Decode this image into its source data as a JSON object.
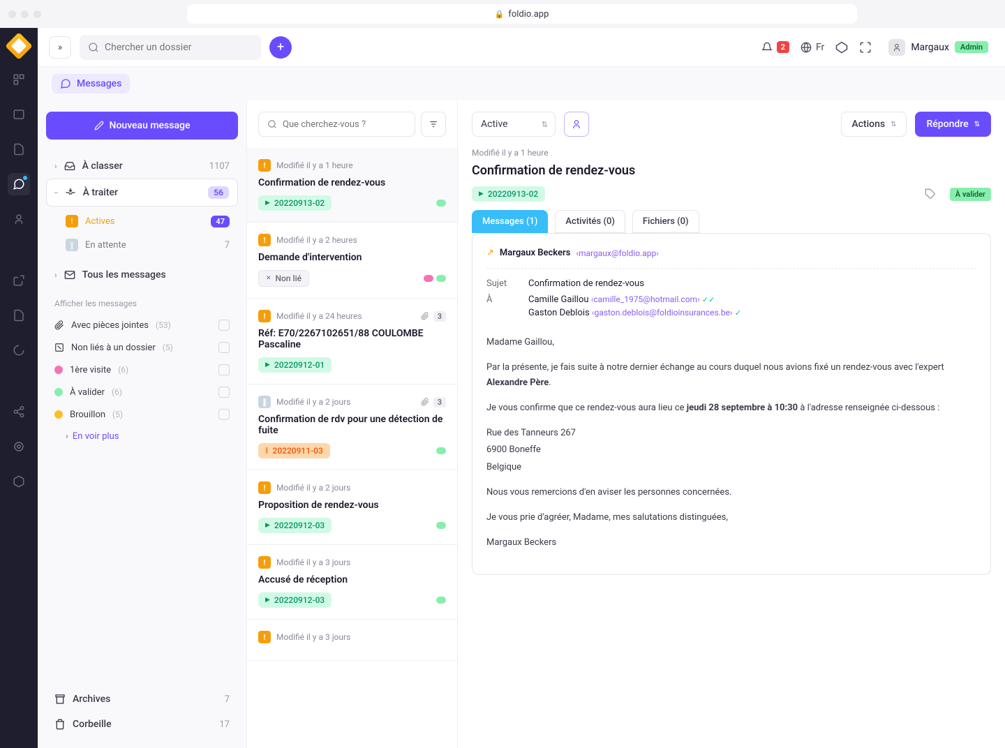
{
  "browser": {
    "url": "foldio.app"
  },
  "topbar": {
    "search_placeholder": "Chercher un dossier",
    "notif_count": "2",
    "lang": "Fr",
    "user_name": "Margaux",
    "user_role": "Admin"
  },
  "breadcrumb": {
    "label": "Messages"
  },
  "sidebar": {
    "new_message": "Nouveau message",
    "nav": {
      "to_classify": {
        "label": "À classer",
        "count": "1107"
      },
      "to_process": {
        "label": "À traiter",
        "count": "56"
      },
      "actives": {
        "label": "Actives",
        "count": "47"
      },
      "waiting": {
        "label": "En attente",
        "count": "7"
      },
      "all": {
        "label": "Tous les messages"
      }
    },
    "filter_header": "Afficher les messages",
    "filters": {
      "attachments": {
        "label": "Avec pièces jointes",
        "count": "(53)"
      },
      "unlinked": {
        "label": "Non liés à un dossier",
        "count": "(5)"
      },
      "first_visit": {
        "label": "1ère visite",
        "count": "(6)"
      },
      "to_validate": {
        "label": "À valider",
        "count": "(6)"
      },
      "draft": {
        "label": "Brouillon",
        "count": "(5)"
      }
    },
    "see_more": "En voir plus",
    "archives": {
      "label": "Archives",
      "count": "7"
    },
    "trash": {
      "label": "Corbeille",
      "count": "17"
    }
  },
  "list": {
    "search_placeholder": "Que cherchez-vous ?",
    "items": [
      {
        "status": "orange",
        "time": "Modifié il y a 1 heure",
        "title": "Confirmation de rendez-vous",
        "ref": "20220913-02",
        "ref_style": "green",
        "tags": [
          "#86efac"
        ],
        "selected": true
      },
      {
        "status": "orange",
        "time": "Modifié il y a 2 heures",
        "title": "Demande d'intervention",
        "ref": "Non lié",
        "ref_style": "gray",
        "tags": [
          "#f472b6",
          "#86efac"
        ]
      },
      {
        "status": "orange",
        "time": "Modifié il y a 24 heures",
        "title": "Réf: E70/2267102651/88 COULOMBE Pascaline",
        "ref": "20220912-01",
        "ref_style": "green",
        "attach": "3"
      },
      {
        "status": "gray",
        "time": "Modifié il y a 2 jours",
        "title": "Confirmation de rdv pour une détection de fuite",
        "ref": "20220911-03",
        "ref_style": "orange",
        "tags": [
          "#86efac"
        ],
        "attach": "3"
      },
      {
        "status": "orange",
        "time": "Modifié il y a 2 jours",
        "title": "Proposition de rendez-vous",
        "ref": "20220912-03",
        "ref_style": "green",
        "tags": [
          "#86efac"
        ]
      },
      {
        "status": "orange",
        "time": "Modifié il y a 3 jours",
        "title": "Accusé de réception",
        "ref": "20220912-03",
        "ref_style": "green",
        "tags": [
          "#86efac"
        ]
      },
      {
        "status": "orange",
        "time": "Modifié il y a 3 jours",
        "title": "",
        "ref": "",
        "ref_style": ""
      }
    ]
  },
  "detail": {
    "status": "Active",
    "actions": "Actions",
    "reply": "Répondre",
    "time": "Modifié il y a 1 heure",
    "title": "Confirmation de rendez-vous",
    "ref": "20220913-02",
    "validate": "À valider",
    "tabs": {
      "messages": "Messages (1)",
      "activities": "Activités (0)",
      "files": "Fichiers (0)"
    },
    "from": {
      "name": "Margaux Beckers",
      "email": "‹margaux@foldio.app›"
    },
    "subject_label": "Sujet",
    "subject": "Confirmation de rendez-vous",
    "to_label": "À",
    "recipients": [
      {
        "name": "Camille Gaillou",
        "email": "‹camille_1975@hotmail.com›",
        "checks": 2
      },
      {
        "name": "Gaston Deblois",
        "email": "‹gaston.deblois@foldioinsurances.be›",
        "checks": 1
      }
    ],
    "body": {
      "p1": "Madame Gaillou,",
      "p2a": "Par la présente, je fais suite à notre dernier échange au cours duquel nous avions fixé un rendez-vous avec l'expert ",
      "p2b": "Alexandre Père",
      "p3a": "Je vous confirme que ce rendez-vous aura lieu ce ",
      "p3b": "jeudi 28 septembre à 10:30",
      "p3c": " à l'adresse renseignée ci-dessous :",
      "addr1": "Rue des Tanneurs 267",
      "addr2": "6900 Boneffe",
      "addr3": "Belgique",
      "p5": "Nous vous remercions d'en aviser les personnes concernées.",
      "p6": "Je vous prie d'agréer, Madame, mes salutations distinguées,",
      "p7": "Margaux Beckers"
    }
  }
}
